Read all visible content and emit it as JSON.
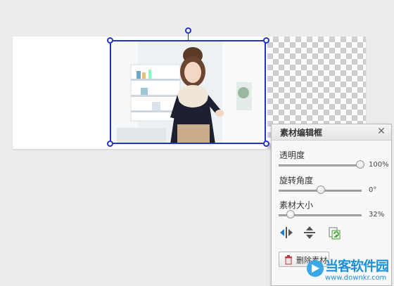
{
  "canvas": {
    "transparent_area": "checkerboard"
  },
  "photo": {
    "description_icon": "photo-girl-image"
  },
  "panel": {
    "title": "素材编辑框",
    "close_icon": "close-icon",
    "opacity": {
      "label": "透明度",
      "value_text": "100%",
      "value": 1.0
    },
    "rotation": {
      "label": "旋转角度",
      "value_text": "0°",
      "value": 0.5
    },
    "size": {
      "label": "素材大小",
      "value_text": "32%",
      "value": 0.1
    },
    "tools": [
      "flip-horizontal-icon",
      "flip-vertical-icon",
      "replace-icon"
    ],
    "delete_button": {
      "label": "删除素材",
      "icon": "trash-icon"
    }
  },
  "watermark": {
    "text": "当客软件园",
    "url": "www.downkr.com"
  },
  "colors": {
    "selection": "#2233c8",
    "watermark": "#1f8fd6"
  }
}
